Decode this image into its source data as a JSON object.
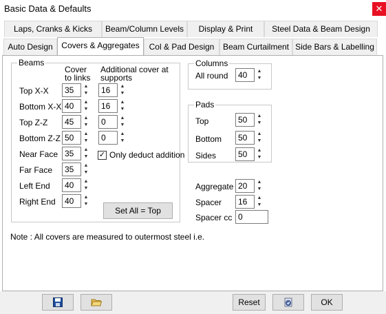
{
  "window": {
    "title": "Basic Data & Defaults",
    "close": "✕"
  },
  "tabs_row1": [
    {
      "label": "Laps, Cranks & Kicks"
    },
    {
      "label": "Beam/Column Levels"
    },
    {
      "label": "Display & Print"
    },
    {
      "label": "Steel Data & Beam Design"
    }
  ],
  "tabs_row2": [
    {
      "label": "Auto Design"
    },
    {
      "label": "Covers & Aggregates",
      "active": true
    },
    {
      "label": "Col & Pad Design"
    },
    {
      "label": "Beam Curtailment"
    },
    {
      "label": "Side Bars & Labelling"
    }
  ],
  "beams": {
    "title": "Beams",
    "col_cover": "Cover\nto links",
    "col_cover_l1": "Cover",
    "col_cover_l2": "to links",
    "col_add_l1": "Additional cover at",
    "col_add_l2": "supports",
    "rows": [
      {
        "label": "Top X-X",
        "cover": "35",
        "additional": "16"
      },
      {
        "label": "Bottom X-X",
        "cover": "40",
        "additional": "16"
      },
      {
        "label": "Top Z-Z",
        "cover": "45",
        "additional": "0"
      },
      {
        "label": "Bottom Z-Z",
        "cover": "50",
        "additional": "0"
      },
      {
        "label": "Near Face",
        "cover": "35"
      },
      {
        "label": "Far Face",
        "cover": "35"
      },
      {
        "label": "Left End",
        "cover": "40"
      },
      {
        "label": "Right End",
        "cover": "40"
      }
    ],
    "only_deduct_label": "Only deduct addition",
    "only_deduct_checked": true,
    "set_all_label": "Set All = Top"
  },
  "columns": {
    "title": "Columns",
    "all_round_label": "All round",
    "all_round_value": "40"
  },
  "pads": {
    "title": "Pads",
    "rows": [
      {
        "label": "Top",
        "value": "50"
      },
      {
        "label": "Bottom",
        "value": "50"
      },
      {
        "label": "Sides",
        "value": "50"
      }
    ]
  },
  "aggregate": {
    "label": "Aggregate",
    "value": "20"
  },
  "spacer": {
    "label": "Spacer",
    "value": "16"
  },
  "spacer_cc": {
    "label": "Spacer cc",
    "value": "0"
  },
  "note": "Note : All covers are measured to outermost steel i.e.",
  "footer": {
    "save_icon": "save-icon",
    "open_icon": "open-folder-icon",
    "reset_label": "Reset",
    "apply_icon": "apply-icon",
    "ok_label": "OK"
  }
}
